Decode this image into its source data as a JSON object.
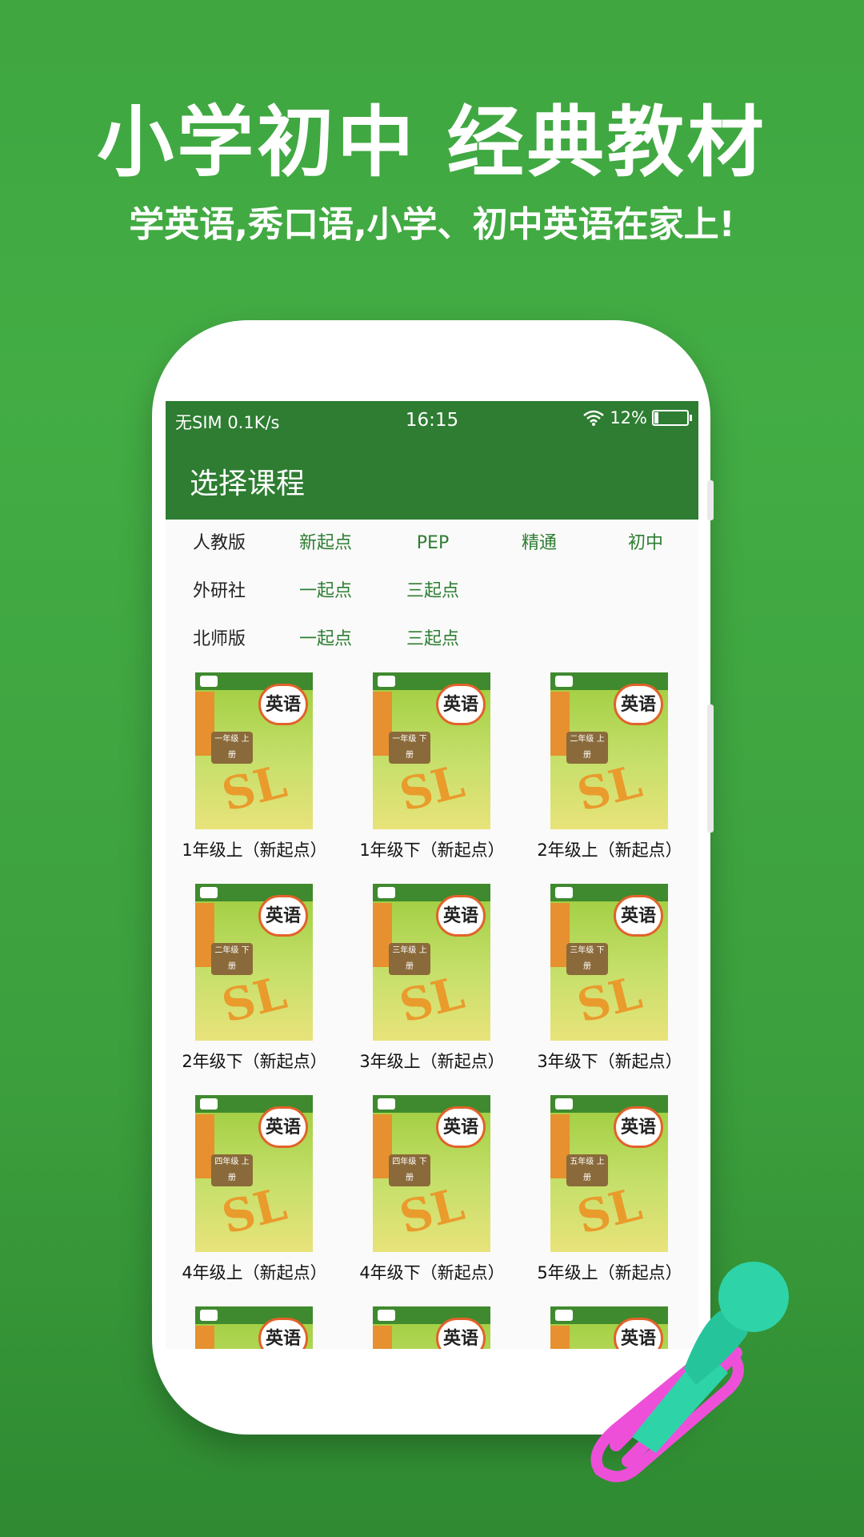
{
  "promo": {
    "headline": "小学初中 经典教材",
    "subline": "学英语,秀口语,小学、初中英语在家上!"
  },
  "status_bar": {
    "carrier": "无SIM 0.1K/s",
    "time": "16:15",
    "battery": "12%",
    "battery_level": 0.12,
    "icons": [
      "wifi-icon",
      "battery-icon"
    ]
  },
  "app_bar": {
    "title": "选择课程"
  },
  "filters": [
    {
      "publisher": "人教版",
      "options": [
        "新起点",
        "PEP",
        "精通",
        "初中"
      ]
    },
    {
      "publisher": "外研社",
      "options": [
        "一起点",
        "三起点"
      ]
    },
    {
      "publisher": "北师版",
      "options": [
        "一起点",
        "三起点"
      ]
    }
  ],
  "books": [
    {
      "cover_title": "英语",
      "grade": "一年级 上册",
      "caption": "1年级上（新起点）"
    },
    {
      "cover_title": "英语",
      "grade": "一年级 下册",
      "caption": "1年级下（新起点）"
    },
    {
      "cover_title": "英语",
      "grade": "二年级 上册",
      "caption": "2年级上（新起点）"
    },
    {
      "cover_title": "英语",
      "grade": "二年级 下册",
      "caption": "2年级下（新起点）"
    },
    {
      "cover_title": "英语",
      "grade": "三年级 上册",
      "caption": "3年级上（新起点）"
    },
    {
      "cover_title": "英语",
      "grade": "三年级 下册",
      "caption": "3年级下（新起点）"
    },
    {
      "cover_title": "英语",
      "grade": "四年级 上册",
      "caption": "4年级上（新起点）"
    },
    {
      "cover_title": "英语",
      "grade": "四年级 下册",
      "caption": "4年级下（新起点）"
    },
    {
      "cover_title": "英语",
      "grade": "五年级 上册",
      "caption": "5年级上（新起点）"
    },
    {
      "cover_title": "英语",
      "grade": "",
      "caption": ""
    },
    {
      "cover_title": "英语",
      "grade": "",
      "caption": ""
    },
    {
      "cover_title": "英语",
      "grade": "",
      "caption": ""
    }
  ],
  "cover_mark": "SL",
  "colors": {
    "background": "#3fa640",
    "app_bar": "#2e7d32",
    "filter_option": "#2e7d32",
    "mic_head": "#2ed3a8",
    "cable": "#ee4fd9"
  }
}
